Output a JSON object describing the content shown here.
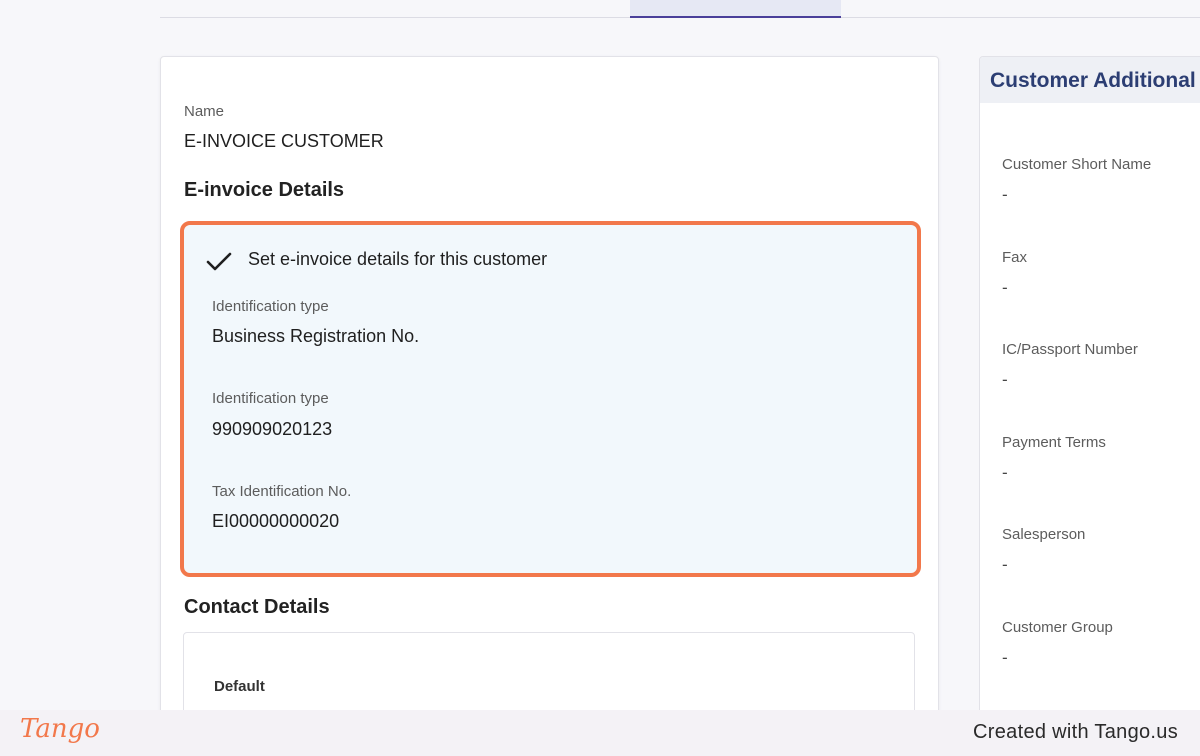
{
  "main": {
    "name_label": "Name",
    "name_value": "E-INVOICE CUSTOMER",
    "einvoice_section_title": "E-invoice Details",
    "einvoice": {
      "checkbox_label": "Set e-invoice details for this customer",
      "checked": true,
      "fields": [
        {
          "label": "Identification type",
          "value": "Business Registration No."
        },
        {
          "label": "Identification type",
          "value": "990909020123"
        },
        {
          "label": "Tax Identification No.",
          "value": "EI00000000020"
        }
      ]
    },
    "contact_section_title": "Contact Details",
    "contact": {
      "default_label": "Default"
    }
  },
  "side": {
    "title": "Customer Additional",
    "fields": [
      {
        "label": "Customer Short Name",
        "value": "-"
      },
      {
        "label": "Fax",
        "value": "-"
      },
      {
        "label": "IC/Passport Number",
        "value": "-"
      },
      {
        "label": "Payment Terms",
        "value": "-"
      },
      {
        "label": "Salesperson",
        "value": "-"
      },
      {
        "label": "Customer Group",
        "value": "-"
      }
    ]
  },
  "footer": {
    "logo_text": "Tango",
    "created_with": "Created with Tango.us"
  },
  "colors": {
    "highlight_border": "#f2784b",
    "einvoice_bg": "#f2f8fc",
    "side_title": "#2c3e73",
    "active_tab": "#4a3f9a"
  }
}
